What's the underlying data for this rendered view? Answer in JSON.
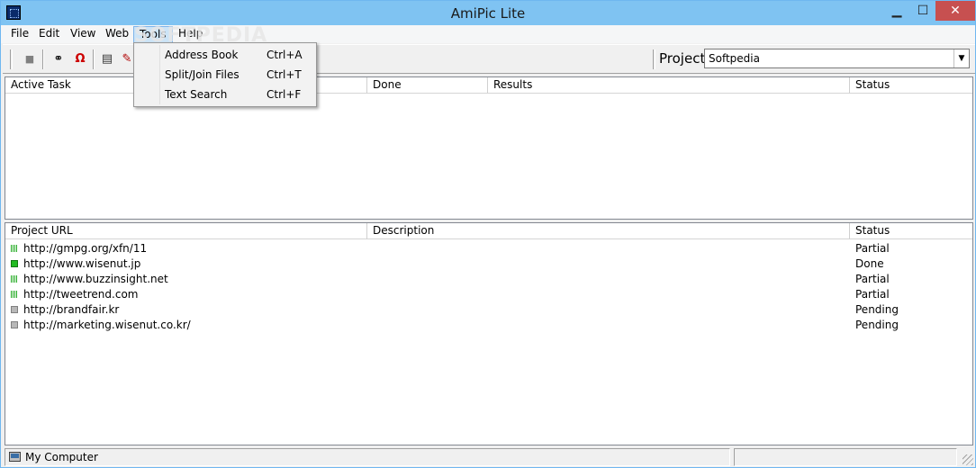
{
  "window": {
    "title": "AmiPic Lite"
  },
  "title_buttons": {
    "minimize": "▁",
    "maximize": "☐",
    "close": "✕"
  },
  "menu": {
    "items": [
      {
        "label": "File"
      },
      {
        "label": "Edit"
      },
      {
        "label": "View"
      },
      {
        "label": "Web"
      },
      {
        "label": "Tools"
      },
      {
        "label": "Help"
      }
    ],
    "active": "Tools"
  },
  "tools_menu": {
    "items": [
      {
        "label": "Address Book",
        "shortcut": "Ctrl+A"
      },
      {
        "label": "Split/Join Files",
        "shortcut": "Ctrl+T"
      },
      {
        "label": "Text Search",
        "shortcut": "Ctrl+F"
      }
    ]
  },
  "watermark": "SOFTPEDIA",
  "toolbar": {
    "icons": [
      "stop-icon",
      "binoculars-icon",
      "magnet-icon",
      "document-search-icon",
      "edit-icon"
    ],
    "project_label": "Project",
    "project_value": "Softpedia"
  },
  "tasks_panel": {
    "columns": [
      "Active Task",
      "Done",
      "Results",
      "Status"
    ],
    "rows": []
  },
  "urls_panel": {
    "columns": [
      "Project URL",
      "Description",
      "Status"
    ],
    "rows": [
      {
        "url": "http://gmpg.org/xfn/11",
        "description": "",
        "status": "Partial",
        "icon": "partial-icon"
      },
      {
        "url": "http://www.wisenut.jp",
        "description": "",
        "status": "Done",
        "icon": "done-icon"
      },
      {
        "url": "http://www.buzzinsight.net",
        "description": "",
        "status": "Partial",
        "icon": "partial-icon"
      },
      {
        "url": "http://tweetrend.com",
        "description": "",
        "status": "Partial",
        "icon": "partial-icon"
      },
      {
        "url": "http://brandfair.kr",
        "description": "",
        "status": "Pending",
        "icon": "pending-icon"
      },
      {
        "url": "http://marketing.wisenut.co.kr/",
        "description": "",
        "status": "Pending",
        "icon": "pending-icon"
      }
    ]
  },
  "statusbar": {
    "text": "My Computer"
  },
  "colors": {
    "titlebar": "#7fc3f2",
    "close_button": "#c75050",
    "menu_highlight": "#cce4f7"
  }
}
